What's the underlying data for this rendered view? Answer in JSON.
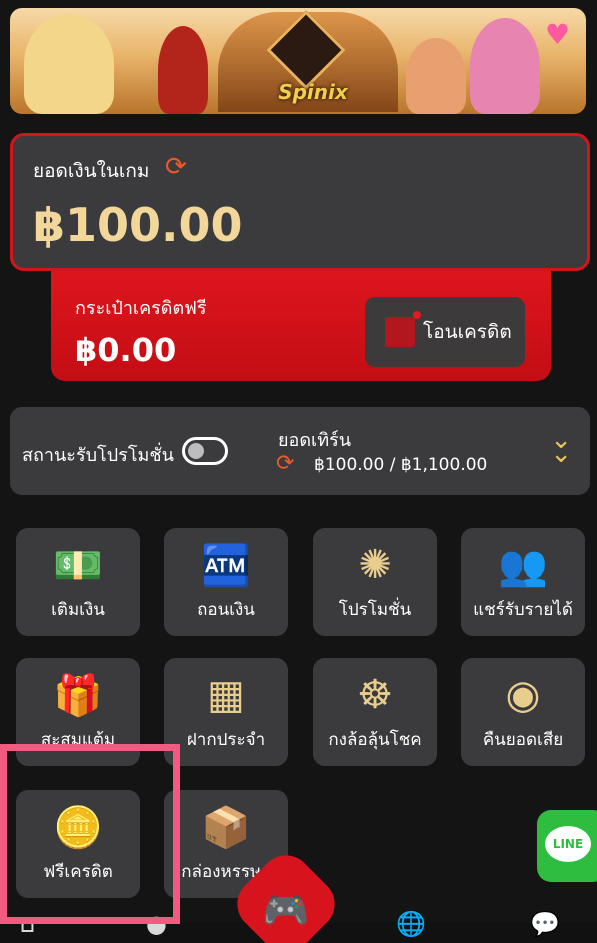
{
  "banner": {
    "logo_text": "Spinix"
  },
  "wallet": {
    "label": "ยอดเงินในเกม",
    "amount": "฿100.00"
  },
  "credit": {
    "label": "กระเป๋าเครดิตฟรี",
    "amount": "฿0.00",
    "transfer_label": "โอนเครดิต"
  },
  "promo": {
    "label": "สถานะรับโปรโมชั่น",
    "turnover_label": "ยอดเทิร์น",
    "turnover_value": "฿100.00 / ฿1,100.00"
  },
  "menu": [
    {
      "label": "เติมเงิน",
      "icon": "deposit-icon"
    },
    {
      "label": "ถอนเงิน",
      "icon": "withdraw-icon"
    },
    {
      "label": "โปรโมชั่น",
      "icon": "promotion-icon"
    },
    {
      "label": "แชร์รับรายได้",
      "icon": "share-users-icon"
    },
    {
      "label": "สะสมแต้ม",
      "icon": "gift-card-icon"
    },
    {
      "label": "ฝากประจำ",
      "icon": "calendar-icon"
    },
    {
      "label": "กงล้อลุ้นโชค",
      "icon": "ferris-wheel-icon"
    },
    {
      "label": "คืนยอดเสีย",
      "icon": "coin-icon"
    },
    {
      "label": "ฟรีเครดิต",
      "icon": "coin-stack-icon"
    },
    {
      "label": "กล่องหรรษา",
      "icon": "gift-box-icon"
    }
  ],
  "line_button": {
    "text": "LINE"
  },
  "colors": {
    "accent_red": "#d7141d",
    "gold": "#f3d79a",
    "card": "#3b3b3e",
    "highlight": "#f05b7f"
  }
}
